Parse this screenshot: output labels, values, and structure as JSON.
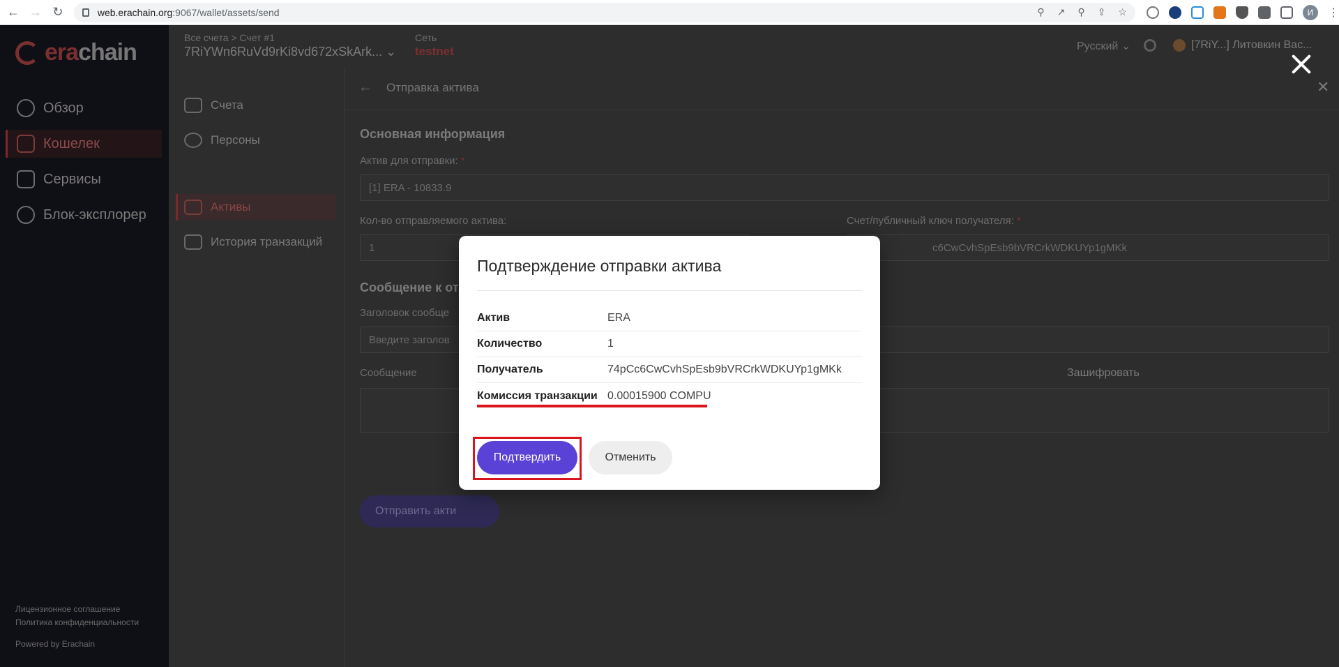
{
  "browser": {
    "url_host": "web.erachain.org",
    "url_path": ":9067/wallet/assets/send",
    "profile_initial": "И"
  },
  "sidebar": {
    "logo_text_a": "era",
    "logo_text_b": "chain",
    "items": [
      {
        "label": "Обзор"
      },
      {
        "label": "Кошелек"
      },
      {
        "label": "Сервисы"
      },
      {
        "label": "Блок-эксплорер"
      }
    ],
    "footer": {
      "license": "Лицензионное соглашение",
      "privacy": "Политика конфиденциальности",
      "powered": "Powered by Erachain"
    }
  },
  "topbar": {
    "account_caption": "Все счета > Счет #1",
    "account_id": "7RiYWn6RuVd9rKi8vd672xSkArk...",
    "network_caption": "Сеть",
    "network_value": "testnet",
    "language": "Русский",
    "user": "[7RiY...] Литовкин Вас..."
  },
  "subnav": {
    "items": [
      {
        "label": "Счета"
      },
      {
        "label": "Персоны"
      },
      {
        "label": "Активы"
      },
      {
        "label": "История транзакций"
      }
    ]
  },
  "page": {
    "title": "Отправка актива",
    "section_main": "Основная информация",
    "asset_label": "Актив для отправки:",
    "asset_value": "[1] ERA - 10833.9",
    "amount_label": "Кол-во отправляемого актива:",
    "amount_value": "1",
    "recipient_label": "Счет/публичный ключ получателя:",
    "recipient_value": "c6CwCvhSpEsb9bVRCrkWDKUYp1gMKk",
    "section_message": "Сообщение к от",
    "msg_title_label": "Заголовок сообще",
    "msg_title_placeholder": "Введите заголов",
    "message_label": "Сообщение",
    "encrypt_label": "Зашифровать",
    "send_button": "Отправить акти"
  },
  "modal": {
    "title": "Подтверждение отправки актива",
    "rows": [
      {
        "key": "Актив",
        "value": "ERA"
      },
      {
        "key": "Количество",
        "value": "1"
      },
      {
        "key": "Получатель",
        "value": "74pCc6CwCvhSpEsb9bVRCrkWDKUYp1gMKk"
      },
      {
        "key": "Комиссия транзакции",
        "value": "0.00015900 COMPU"
      }
    ],
    "confirm_label": "Подтвердить",
    "cancel_label": "Отменить"
  }
}
